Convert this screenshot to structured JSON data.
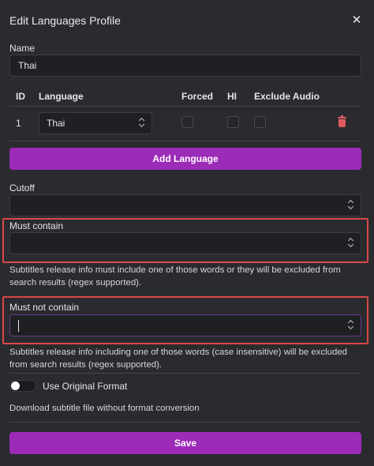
{
  "header": {
    "title": "Edit Languages Profile",
    "close_glyph": "✕"
  },
  "name": {
    "label": "Name",
    "value": "Thai"
  },
  "languages_table": {
    "columns": [
      "ID",
      "Language",
      "Forced",
      "HI",
      "Exclude Audio"
    ],
    "rows": [
      {
        "id": "1",
        "language": "Thai",
        "forced": false,
        "hi": false,
        "exclude_audio": false
      }
    ]
  },
  "add_language_label": "Add Language",
  "cutoff": {
    "label": "Cutoff",
    "value": ""
  },
  "must_contain": {
    "label": "Must contain",
    "value": "",
    "hint": "Subtitles release info must include one of those words or they will be excluded from search results (regex supported)."
  },
  "must_not_contain": {
    "label": "Must not contain",
    "value": "",
    "hint": "Subtitles release info including one of those words (case insensitive) will be excluded from search results (regex supported)."
  },
  "original_format": {
    "label": "Use Original Format",
    "enabled": false,
    "hint": "Download subtitle file without format conversion"
  },
  "save_label": "Save",
  "colors": {
    "accent": "#9c2bb8",
    "highlight": "#d94848",
    "danger": "#e05a62",
    "background": "#2a2b2f"
  }
}
